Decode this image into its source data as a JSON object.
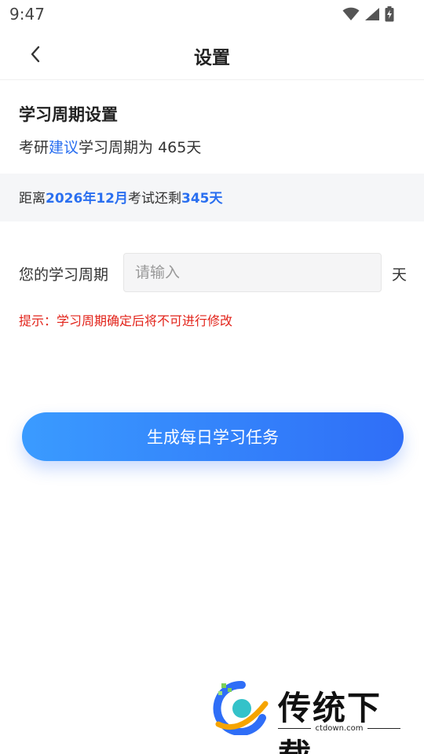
{
  "status_bar": {
    "time": "9:47"
  },
  "nav": {
    "title": "设置"
  },
  "section": {
    "title": "学习周期设置",
    "suggest_prefix": "考研",
    "suggest_link": "建议",
    "suggest_suffix": "学习周期为 465天"
  },
  "countdown": {
    "prefix": "距离",
    "exam_date": "2026年12月",
    "middle": "考试还剩",
    "days": "345天"
  },
  "form": {
    "label": "您的学习周期",
    "placeholder": "请输入",
    "value": "",
    "unit": "天"
  },
  "hint": "提示：学习周期确定后将不可进行修改",
  "actions": {
    "generate_label": "生成每日学习任务"
  },
  "watermark": {
    "brand": "传统下载",
    "domain": "ctdown.com"
  },
  "colors": {
    "accent": "#2a6ff0",
    "warning": "#e2231a",
    "button_start": "#3a9bff",
    "button_end": "#2f6ef7"
  }
}
